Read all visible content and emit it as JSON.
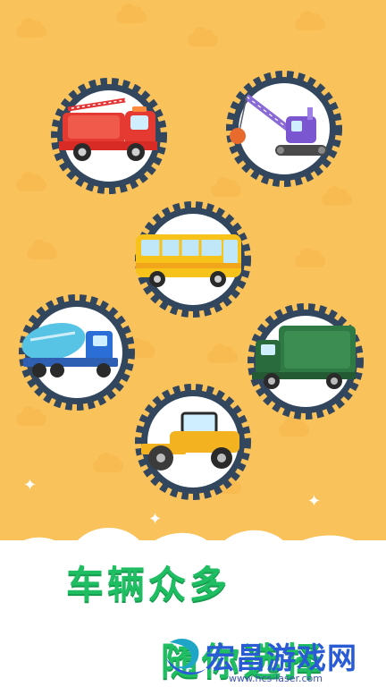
{
  "screen": {
    "caption_line_1": "车辆众多",
    "caption_line_2": "随你选择"
  },
  "vehicles": [
    {
      "name": "fire-truck",
      "icon": "fire-truck-icon"
    },
    {
      "name": "crane",
      "icon": "crane-icon"
    },
    {
      "name": "school-bus",
      "icon": "bus-icon"
    },
    {
      "name": "cement-mixer",
      "icon": "mixer-truck-icon"
    },
    {
      "name": "garbage-truck",
      "icon": "garbage-truck-icon"
    },
    {
      "name": "road-roller",
      "icon": "road-roller-icon"
    }
  ],
  "watermark": {
    "title": "宏昌游戏网",
    "url": "www.hcs-laser.com"
  },
  "colors": {
    "background": "#f9c25a",
    "gear": "#32465e",
    "caption": "#1fbe62",
    "watermark": "#2a5bd7"
  }
}
